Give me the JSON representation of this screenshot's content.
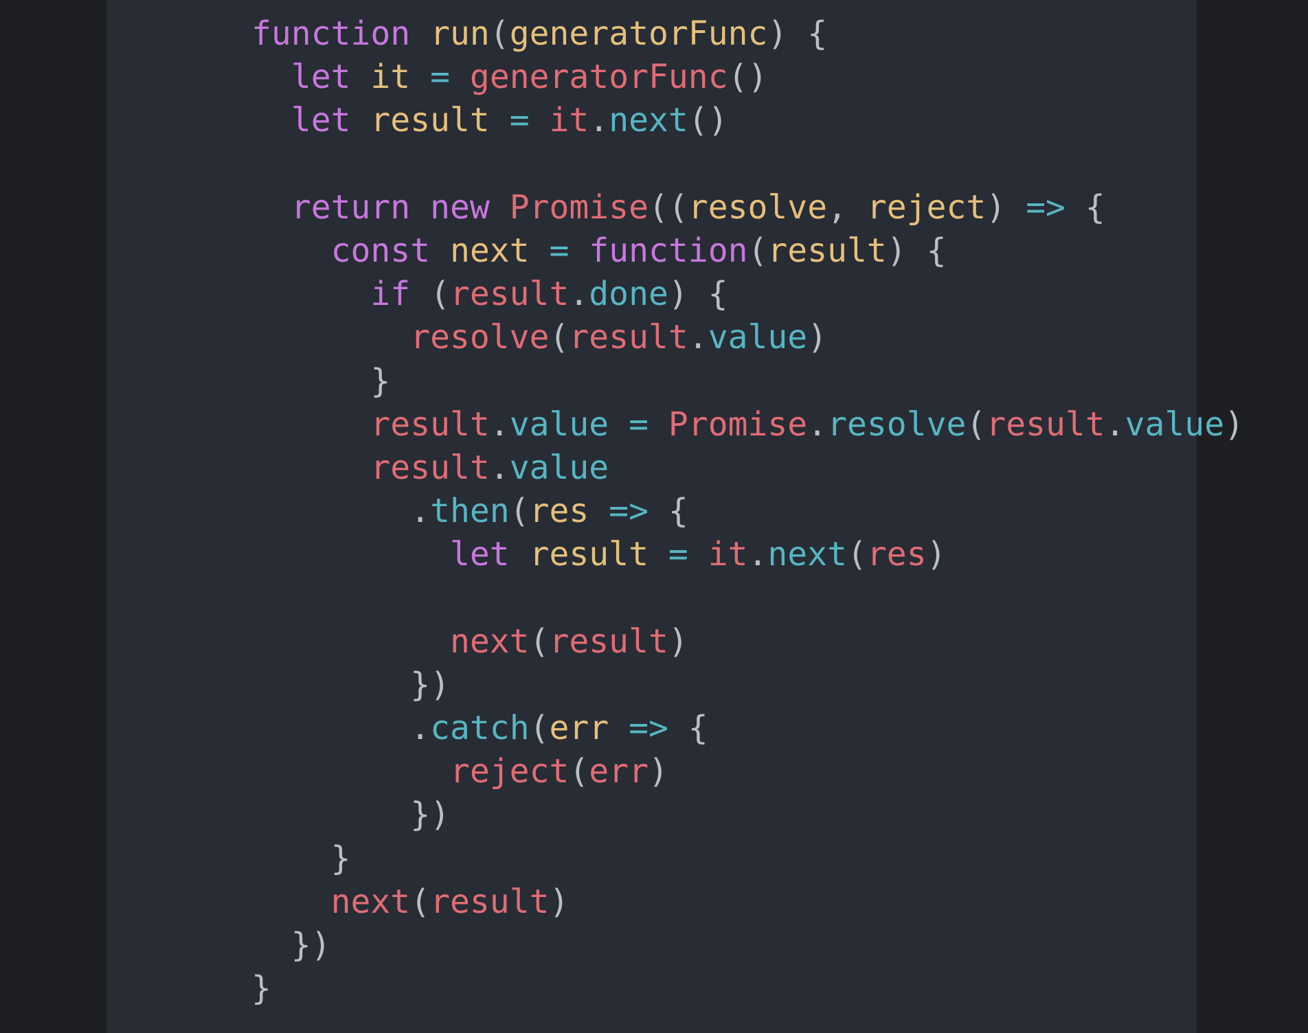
{
  "colors": {
    "background": "#1e1f22",
    "panel": "#282c34",
    "keyword": "#c678dd",
    "identifier": "#e5c07b",
    "variable": "#e06c75",
    "property": "#56b6c2",
    "punctuation": "#b9bec8"
  },
  "code": {
    "lines": [
      [
        [
          "kw",
          "function"
        ],
        [
          "pun",
          " "
        ],
        [
          "fn",
          "run"
        ],
        [
          "pun",
          "("
        ],
        [
          "fn",
          "generatorFunc"
        ],
        [
          "pun",
          ") {"
        ]
      ],
      [
        [
          "pun",
          "  "
        ],
        [
          "kw",
          "let"
        ],
        [
          "pun",
          " "
        ],
        [
          "fn",
          "it"
        ],
        [
          "pun",
          " "
        ],
        [
          "prop",
          "="
        ],
        [
          "pun",
          " "
        ],
        [
          "var",
          "generatorFunc"
        ],
        [
          "pun",
          "()"
        ]
      ],
      [
        [
          "pun",
          "  "
        ],
        [
          "kw",
          "let"
        ],
        [
          "pun",
          " "
        ],
        [
          "fn",
          "result"
        ],
        [
          "pun",
          " "
        ],
        [
          "prop",
          "="
        ],
        [
          "pun",
          " "
        ],
        [
          "var",
          "it"
        ],
        [
          "pun",
          "."
        ],
        [
          "prop",
          "next"
        ],
        [
          "pun",
          "()"
        ]
      ],
      [
        [
          "pun",
          ""
        ]
      ],
      [
        [
          "pun",
          "  "
        ],
        [
          "kw",
          "return"
        ],
        [
          "pun",
          " "
        ],
        [
          "kw",
          "new"
        ],
        [
          "pun",
          " "
        ],
        [
          "var",
          "Promise"
        ],
        [
          "pun",
          "(("
        ],
        [
          "fn",
          "resolve"
        ],
        [
          "pun",
          ", "
        ],
        [
          "fn",
          "reject"
        ],
        [
          "pun",
          ") "
        ],
        [
          "prop",
          "=>"
        ],
        [
          "pun",
          " {"
        ]
      ],
      [
        [
          "pun",
          "    "
        ],
        [
          "kw",
          "const"
        ],
        [
          "pun",
          " "
        ],
        [
          "fn",
          "next"
        ],
        [
          "pun",
          " "
        ],
        [
          "prop",
          "="
        ],
        [
          "pun",
          " "
        ],
        [
          "kw",
          "function"
        ],
        [
          "pun",
          "("
        ],
        [
          "fn",
          "result"
        ],
        [
          "pun",
          ") {"
        ]
      ],
      [
        [
          "pun",
          "      "
        ],
        [
          "kw",
          "if"
        ],
        [
          "pun",
          " ("
        ],
        [
          "var",
          "result"
        ],
        [
          "pun",
          "."
        ],
        [
          "prop",
          "done"
        ],
        [
          "pun",
          ") {"
        ]
      ],
      [
        [
          "pun",
          "        "
        ],
        [
          "var",
          "resolve"
        ],
        [
          "pun",
          "("
        ],
        [
          "var",
          "result"
        ],
        [
          "pun",
          "."
        ],
        [
          "prop",
          "value"
        ],
        [
          "pun",
          ")"
        ]
      ],
      [
        [
          "pun",
          "      }"
        ]
      ],
      [
        [
          "pun",
          "      "
        ],
        [
          "var",
          "result"
        ],
        [
          "pun",
          "."
        ],
        [
          "prop",
          "value"
        ],
        [
          "pun",
          " "
        ],
        [
          "prop",
          "="
        ],
        [
          "pun",
          " "
        ],
        [
          "var",
          "Promise"
        ],
        [
          "pun",
          "."
        ],
        [
          "prop",
          "resolve"
        ],
        [
          "pun",
          "("
        ],
        [
          "var",
          "result"
        ],
        [
          "pun",
          "."
        ],
        [
          "prop",
          "value"
        ],
        [
          "pun",
          ")"
        ]
      ],
      [
        [
          "pun",
          "      "
        ],
        [
          "var",
          "result"
        ],
        [
          "pun",
          "."
        ],
        [
          "prop",
          "value"
        ]
      ],
      [
        [
          "pun",
          "        ."
        ],
        [
          "prop",
          "then"
        ],
        [
          "pun",
          "("
        ],
        [
          "fn",
          "res"
        ],
        [
          "pun",
          " "
        ],
        [
          "prop",
          "=>"
        ],
        [
          "pun",
          " {"
        ]
      ],
      [
        [
          "pun",
          "          "
        ],
        [
          "kw",
          "let"
        ],
        [
          "pun",
          " "
        ],
        [
          "fn",
          "result"
        ],
        [
          "pun",
          " "
        ],
        [
          "prop",
          "="
        ],
        [
          "pun",
          " "
        ],
        [
          "var",
          "it"
        ],
        [
          "pun",
          "."
        ],
        [
          "prop",
          "next"
        ],
        [
          "pun",
          "("
        ],
        [
          "var",
          "res"
        ],
        [
          "pun",
          ")"
        ]
      ],
      [
        [
          "pun",
          ""
        ]
      ],
      [
        [
          "pun",
          "          "
        ],
        [
          "var",
          "next"
        ],
        [
          "pun",
          "("
        ],
        [
          "var",
          "result"
        ],
        [
          "pun",
          ")"
        ]
      ],
      [
        [
          "pun",
          "        })"
        ]
      ],
      [
        [
          "pun",
          "        ."
        ],
        [
          "prop",
          "catch"
        ],
        [
          "pun",
          "("
        ],
        [
          "fn",
          "err"
        ],
        [
          "pun",
          " "
        ],
        [
          "prop",
          "=>"
        ],
        [
          "pun",
          " {"
        ]
      ],
      [
        [
          "pun",
          "          "
        ],
        [
          "var",
          "reject"
        ],
        [
          "pun",
          "("
        ],
        [
          "var",
          "err"
        ],
        [
          "pun",
          ")"
        ]
      ],
      [
        [
          "pun",
          "        })"
        ]
      ],
      [
        [
          "pun",
          "    }"
        ]
      ],
      [
        [
          "pun",
          "    "
        ],
        [
          "var",
          "next"
        ],
        [
          "pun",
          "("
        ],
        [
          "var",
          "result"
        ],
        [
          "pun",
          ")"
        ]
      ],
      [
        [
          "pun",
          "  })"
        ]
      ],
      [
        [
          "pun",
          "}"
        ]
      ]
    ]
  }
}
